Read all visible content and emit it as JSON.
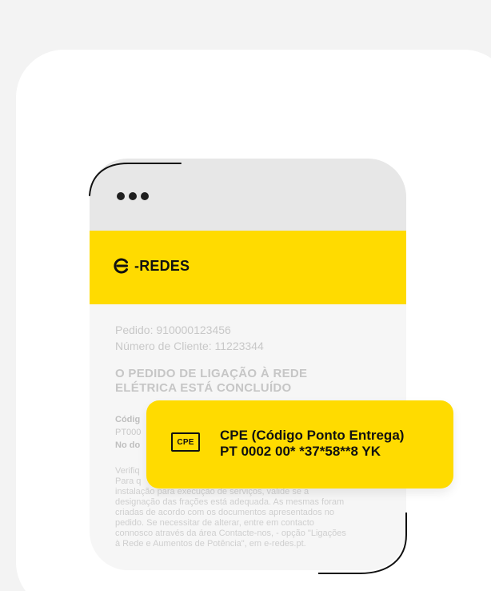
{
  "brand": {
    "logo_text": "-REDES"
  },
  "request": {
    "pedido": "Pedido: 910000123456",
    "cliente": "Número de Cliente: 11223344",
    "headline_line1": "O PEDIDO DE LIGAÇÃO À REDE",
    "headline_line2": "ELÉTRICA ESTÁ CONCLUÍDO",
    "meta_label_1": "Códig",
    "meta_value_1": "PT000",
    "meta_label_2": "No do",
    "paragraph_lines": [
      "Verifiq",
      "Para q",
      "instalação para execução de serviços, valide se a",
      "designação das frações está adequada. As mesmas foram",
      "criadas de acordo com os documentos apresentados no",
      "pedido. Se necessitar de alterar, entre em contacto",
      "connosco através da área Contacte-nos, - opção \"Ligações",
      "à Rede e Aumentos de Potência\", em e-redes.pt."
    ]
  },
  "popup": {
    "icon_label": "CPE",
    "title": "CPE (Código Ponto Entrega)",
    "value": "PT 0002 00* *37*58**8 YK"
  },
  "colors": {
    "brand_yellow": "#ffdb00",
    "page_bg": "#f3f3f3",
    "card_bg": "#ffffff",
    "phone_bg": "#f6f6f6"
  }
}
